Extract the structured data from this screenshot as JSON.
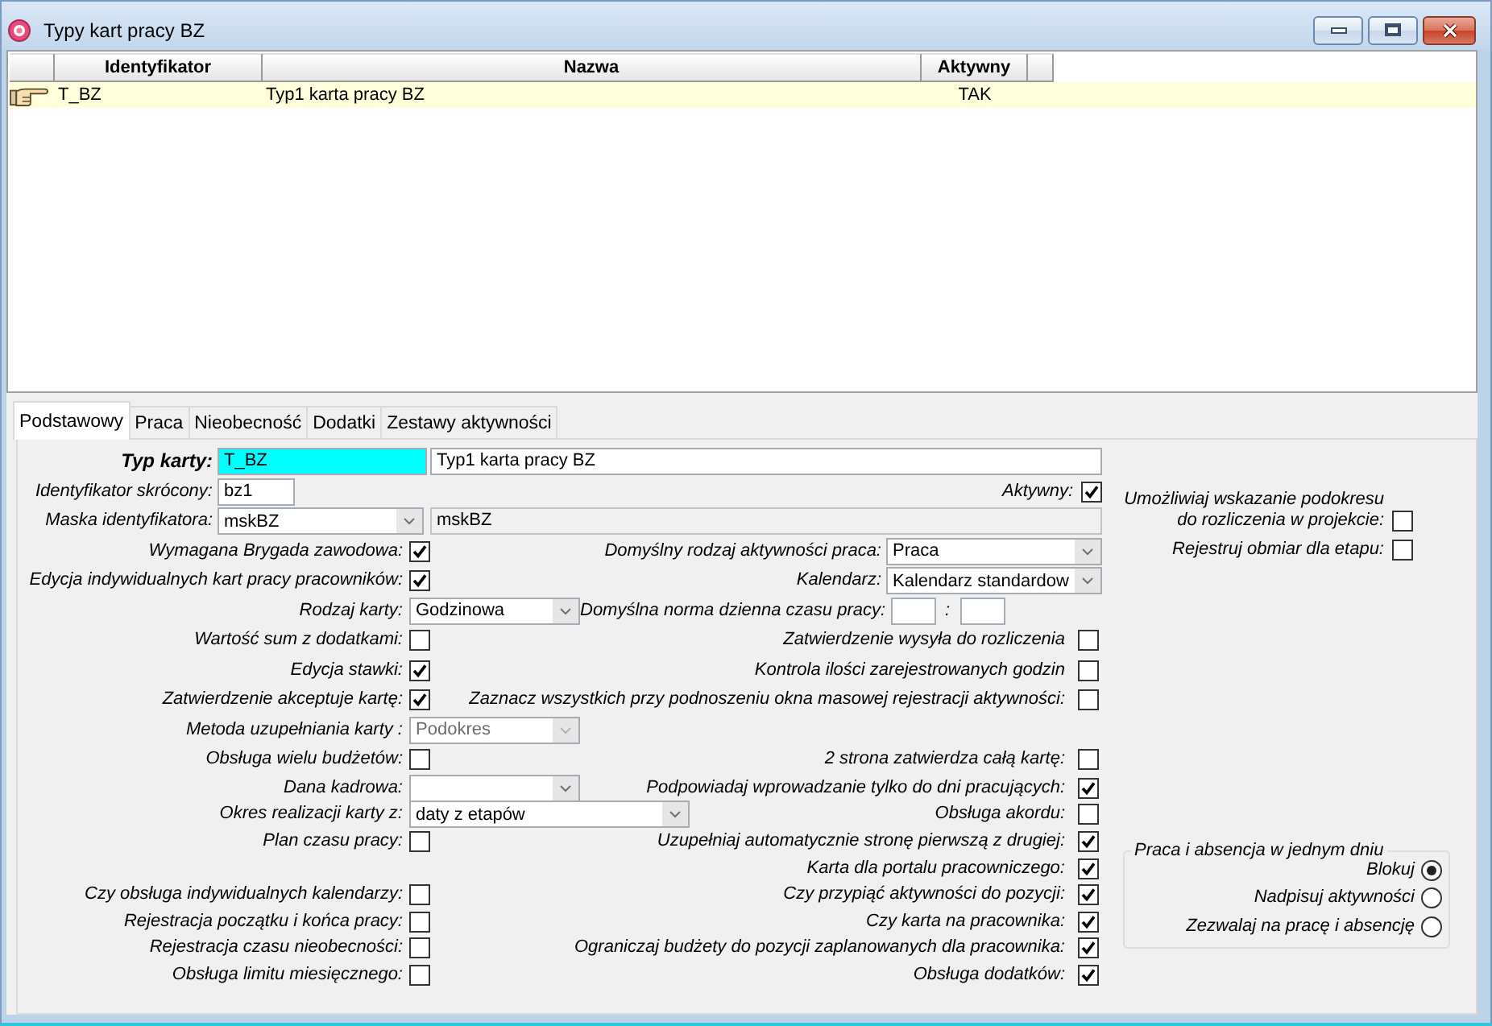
{
  "window": {
    "title": "Typy kart pracy BZ"
  },
  "list": {
    "columns": [
      "Identyfikator",
      "Nazwa",
      "Aktywny"
    ],
    "rows": [
      {
        "cells": [
          "T_BZ",
          "Typ1 karta pracy BZ",
          "TAK"
        ],
        "selected": true
      }
    ]
  },
  "tabs": [
    {
      "label": "Podstawowy",
      "selected": true
    },
    {
      "label": "Praca",
      "selected": false
    },
    {
      "label": "Nieobecność",
      "selected": false
    },
    {
      "label": "Dodatki",
      "selected": false
    },
    {
      "label": "Zestawy aktywności",
      "selected": false
    }
  ],
  "card_type": {
    "label": "Typ karty:",
    "code": "T_BZ",
    "focused": true,
    "name": "Typ1 karta pracy BZ"
  },
  "short_id": {
    "label": "Identyfikator skrócony:",
    "value": "bz1"
  },
  "active": {
    "label": "Aktywny:",
    "checked": true
  },
  "id_mask": {
    "label": "Maska identyfikatora:",
    "value": "mskBZ",
    "description": "mskBZ"
  },
  "rows": [
    {
      "left": {
        "kind": "checkbox",
        "label": "Wymagana Brygada zawodowa:",
        "checked": true
      },
      "middle": {
        "kind": "combo",
        "label": "Domyślny rodzaj aktywności praca:",
        "value": "Praca",
        "disabled": false
      }
    },
    {
      "left": {
        "kind": "checkbox",
        "label": "Edycja indywidualnych kart pracy pracowników:",
        "checked": true
      },
      "middle": {
        "kind": "combo",
        "label": "Kalendarz:",
        "value": "Kalendarz standardow",
        "disabled": false
      }
    },
    {
      "left": {
        "kind": "combo",
        "label": "Rodzaj karty:",
        "value": "Godzinowa",
        "disabled": false
      },
      "middle": {
        "kind": "time",
        "label": "Domyślna norma dzienna czasu pracy:",
        "separator": ":"
      }
    },
    {
      "left": {
        "kind": "checkbox",
        "label": "Wartość sum z dodatkami:",
        "checked": false
      },
      "middle": {
        "kind": "checkbox",
        "label": "Zatwierdzenie wysyła do rozliczenia",
        "checked": false
      }
    },
    {
      "left": {
        "kind": "checkbox",
        "label": "Edycja stawki:",
        "checked": true
      },
      "middle": {
        "kind": "checkbox",
        "label": "Kontrola ilości zarejestrowanych godzin",
        "checked": false
      }
    },
    {
      "left": {
        "kind": "checkbox",
        "label": "Zatwierdzenie akceptuje kartę:",
        "checked": true
      },
      "middle": {
        "kind": "checkbox",
        "label": "Zaznacz wszystkich przy podnoszeniu okna masowej rejestracji aktywności:",
        "checked": false
      }
    },
    {
      "left": {
        "kind": "combo",
        "label": "Metoda uzupełniania karty :",
        "value": "Podokres",
        "disabled": true
      }
    },
    {
      "left": {
        "kind": "checkbox",
        "label": "Obsługa wielu budżetów:",
        "checked": false
      },
      "middle": {
        "kind": "checkbox",
        "label": "2 strona zatwierdza całą kartę:",
        "checked": false
      }
    },
    {
      "left": {
        "kind": "combo",
        "label": "Dana kadrowa:",
        "disabled": false
      },
      "middle": {
        "kind": "checkbox",
        "label": "Podpowiadaj wprowadzanie tylko do dni pracujących:",
        "checked": true
      }
    },
    {
      "left": {
        "kind": "combo",
        "label": "Okres realizacji karty z:",
        "value": "daty z etapów",
        "disabled": false
      },
      "middle": {
        "kind": "checkbox",
        "label": "Obsługa akordu:",
        "checked": false
      }
    },
    {
      "left": {
        "kind": "checkbox",
        "label": "Plan czasu pracy:",
        "checked": false
      },
      "middle": {
        "kind": "checkbox",
        "label": "Uzupełniaj automatycznie stronę pierwszą z drugiej:",
        "checked": true
      }
    },
    {
      "middle": {
        "kind": "checkbox",
        "label": "Karta dla portalu pracowniczego:",
        "checked": true
      }
    },
    {
      "left": {
        "kind": "checkbox",
        "label": "Czy obsługa indywidualnych kalendarzy:",
        "checked": false
      },
      "middle": {
        "kind": "checkbox",
        "label": "Czy przypiąć aktywności do pozycji:",
        "checked": true
      }
    },
    {
      "left": {
        "kind": "checkbox",
        "label": "Rejestracja początku i końca pracy:",
        "checked": false
      },
      "middle": {
        "kind": "checkbox",
        "label": "Czy karta na pracownika:",
        "checked": true
      }
    },
    {
      "left": {
        "kind": "checkbox",
        "label": "Rejestracja czasu nieobecności:",
        "checked": false
      },
      "middle": {
        "kind": "checkbox",
        "label": "Ograniczaj budżety do pozycji zaplanowanych dla pracownika:",
        "checked": true
      }
    },
    {
      "left": {
        "kind": "checkbox",
        "label": "Obsługa limitu miesięcznego:",
        "checked": false
      },
      "middle": {
        "kind": "checkbox",
        "label": "Obsługa dodatków:",
        "checked": true
      }
    }
  ],
  "side_options": [
    {
      "label": "Umożliwiaj wskazanie podokresu do rozliczenia w projekcie:",
      "checked": false
    },
    {
      "label": "Rejestruj obmiar dla etapu:",
      "checked": false
    }
  ],
  "absence_group": {
    "title": "Praca i absencja w jednym dniu",
    "options": [
      {
        "label": "Blokuj",
        "selected": true
      },
      {
        "label": "Nadpisuj aktywności",
        "selected": false
      },
      {
        "label": "Zezwalaj na pracę i absencję",
        "selected": false
      }
    ]
  }
}
